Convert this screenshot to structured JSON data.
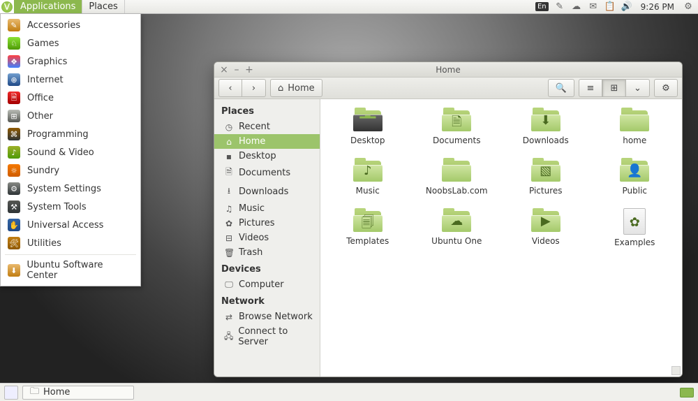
{
  "panel": {
    "applications": "Applications",
    "places": "Places",
    "lang": "En",
    "time": "9:26 PM"
  },
  "app_menu": [
    {
      "label": "Accessories",
      "color": "linear-gradient(#e9b96e,#c17d11)",
      "glyph": "✎"
    },
    {
      "label": "Games",
      "color": "linear-gradient(#8ae234,#4e9a06)",
      "glyph": "♘"
    },
    {
      "label": "Graphics",
      "color": "linear-gradient(#ff4040,#4080ff)",
      "glyph": "❖"
    },
    {
      "label": "Internet",
      "color": "linear-gradient(#729fcf,#204a87)",
      "glyph": "⊕"
    },
    {
      "label": "Office",
      "color": "linear-gradient(#ef2929,#a40000)",
      "glyph": "🗎"
    },
    {
      "label": "Other",
      "color": "linear-gradient(#babdb6,#555753)",
      "glyph": "⊞"
    },
    {
      "label": "Programming",
      "color": "linear-gradient(#8f5902,#2e3436)",
      "glyph": "⌘"
    },
    {
      "label": "Sound & Video",
      "color": "linear-gradient(#9db029,#4e9a06)",
      "glyph": "♪"
    },
    {
      "label": "Sundry",
      "color": "linear-gradient(#f57900,#ce5c00)",
      "glyph": "☼"
    },
    {
      "label": "System Settings",
      "color": "linear-gradient(#888a85,#2e3436)",
      "glyph": "⚙"
    },
    {
      "label": "System Tools",
      "color": "linear-gradient(#555753,#2e3436)",
      "glyph": "⚒"
    },
    {
      "label": "Universal Access",
      "color": "linear-gradient(#3465a4,#204a87)",
      "glyph": "✋"
    },
    {
      "label": "Utilities",
      "color": "linear-gradient(#c17d11,#8f5902)",
      "glyph": "🛠"
    }
  ],
  "app_menu_extra": {
    "label": "Ubuntu Software Center"
  },
  "taskbar": {
    "task1": "Home"
  },
  "fm": {
    "title": "Home",
    "home_btn": "Home",
    "sidebar": {
      "places_head": "Places",
      "places": [
        {
          "icon": "◷",
          "label": "Recent"
        },
        {
          "icon": "⌂",
          "label": "Home",
          "selected": true
        },
        {
          "icon": "▪",
          "label": "Desktop"
        },
        {
          "icon": "🗎",
          "label": "Documents"
        },
        {
          "icon": "⭳",
          "label": "Downloads"
        },
        {
          "icon": "♫",
          "label": "Music"
        },
        {
          "icon": "✿",
          "label": "Pictures"
        },
        {
          "icon": "⊟",
          "label": "Videos"
        },
        {
          "icon": "🗑",
          "label": "Trash"
        }
      ],
      "devices_head": "Devices",
      "devices": [
        {
          "icon": "🖵",
          "label": "Computer"
        }
      ],
      "network_head": "Network",
      "network": [
        {
          "icon": "⇄",
          "label": "Browse Network"
        },
        {
          "icon": "🖧",
          "label": "Connect to Server"
        }
      ]
    },
    "folders": [
      {
        "label": "Desktop",
        "variant": "desktop",
        "emblem": "▂▃▂"
      },
      {
        "label": "Documents",
        "emblem": "🗎"
      },
      {
        "label": "Downloads",
        "emblem": "⬇"
      },
      {
        "label": "home",
        "emblem": ""
      },
      {
        "label": "Music",
        "emblem": "♪"
      },
      {
        "label": "NoobsLab.com",
        "emblem": ""
      },
      {
        "label": "Pictures",
        "emblem": "▧"
      },
      {
        "label": "Public",
        "emblem": "👤"
      },
      {
        "label": "Templates",
        "emblem": "🗐"
      },
      {
        "label": "Ubuntu One",
        "emblem": "☁"
      },
      {
        "label": "Videos",
        "emblem": "▶"
      },
      {
        "label": "Examples",
        "variant": "examples",
        "emblem": "✿"
      }
    ]
  }
}
